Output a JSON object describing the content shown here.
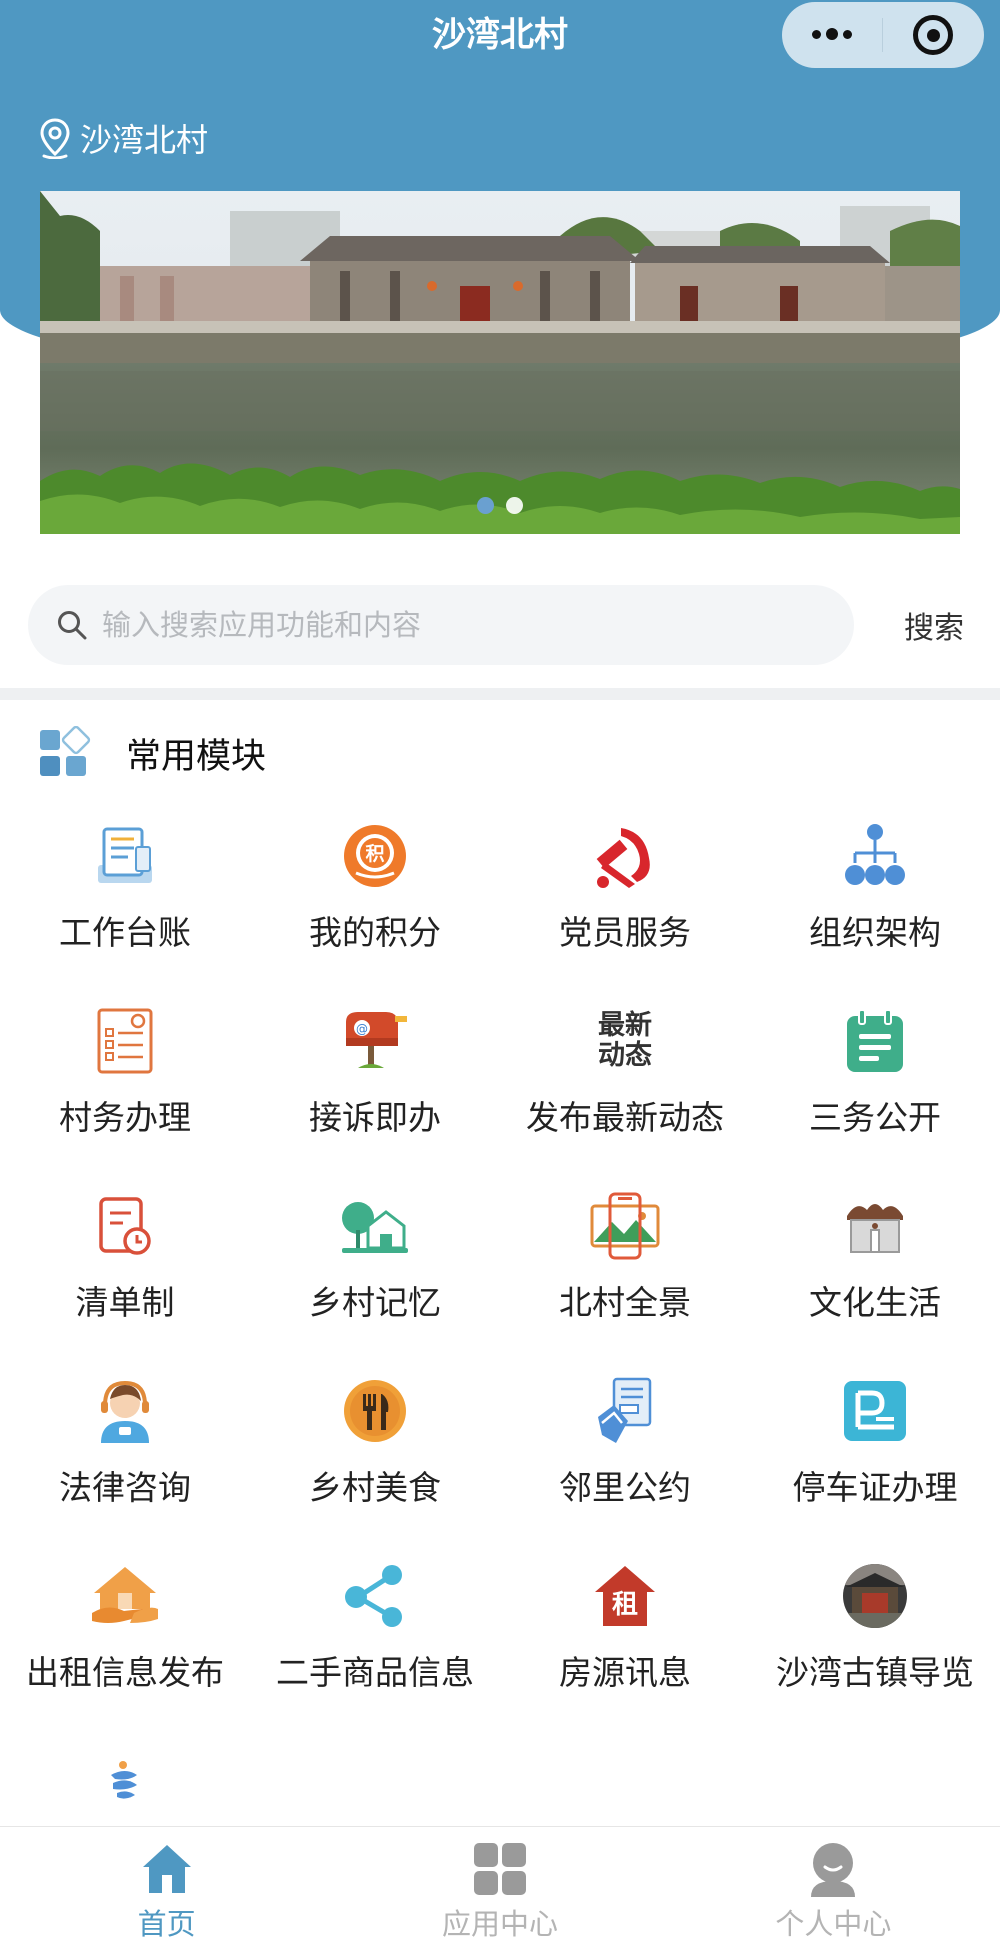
{
  "nav": {
    "title": "沙湾北村"
  },
  "location": {
    "label": "沙湾北村"
  },
  "banner": {
    "dots": 2,
    "active_index": 0
  },
  "search": {
    "placeholder": "输入搜索应用功能和内容",
    "value": "",
    "button_label": "搜索"
  },
  "section": {
    "title": "常用模块"
  },
  "modules": [
    {
      "label": "工作台账",
      "icon": "ledger-icon"
    },
    {
      "label": "我的积分",
      "icon": "points-icon"
    },
    {
      "label": "党员服务",
      "icon": "party-emblem-icon"
    },
    {
      "label": "组织架构",
      "icon": "org-chart-icon"
    },
    {
      "label": "村务办理",
      "icon": "checklist-icon"
    },
    {
      "label": "接诉即办",
      "icon": "mailbox-icon"
    },
    {
      "label": "发布最新动态",
      "icon": "news-icon",
      "icon_text": [
        "最新",
        "动态"
      ]
    },
    {
      "label": "三务公开",
      "icon": "notepad-icon"
    },
    {
      "label": "清单制",
      "icon": "clock-list-icon"
    },
    {
      "label": "乡村记忆",
      "icon": "village-memory-icon"
    },
    {
      "label": "北村全景",
      "icon": "panorama-phone-icon"
    },
    {
      "label": "文化生活",
      "icon": "culture-building-icon"
    },
    {
      "label": "法律咨询",
      "icon": "legal-consultant-icon"
    },
    {
      "label": "乡村美食",
      "icon": "food-icon"
    },
    {
      "label": "邻里公约",
      "icon": "convention-document-icon"
    },
    {
      "label": "停车证办理",
      "icon": "parking-permit-icon"
    },
    {
      "label": "出租信息发布",
      "icon": "rental-house-icon"
    },
    {
      "label": "二手商品信息",
      "icon": "share-icon"
    },
    {
      "label": "房源讯息",
      "icon": "rent-house-icon",
      "icon_text": [
        "租"
      ]
    },
    {
      "label": "沙湾古镇导览",
      "icon": "ancient-town-guide-icon"
    },
    {
      "label": "",
      "icon": "partial-icon"
    }
  ],
  "tabbar": [
    {
      "label": "首页",
      "icon": "home-icon",
      "active": true
    },
    {
      "label": "应用中心",
      "icon": "app-grid-icon",
      "active": false
    },
    {
      "label": "个人中心",
      "icon": "user-icon",
      "active": false
    }
  ],
  "colors": {
    "brand": "#4f98c2",
    "inactive_tab": "#b4b4b4"
  }
}
